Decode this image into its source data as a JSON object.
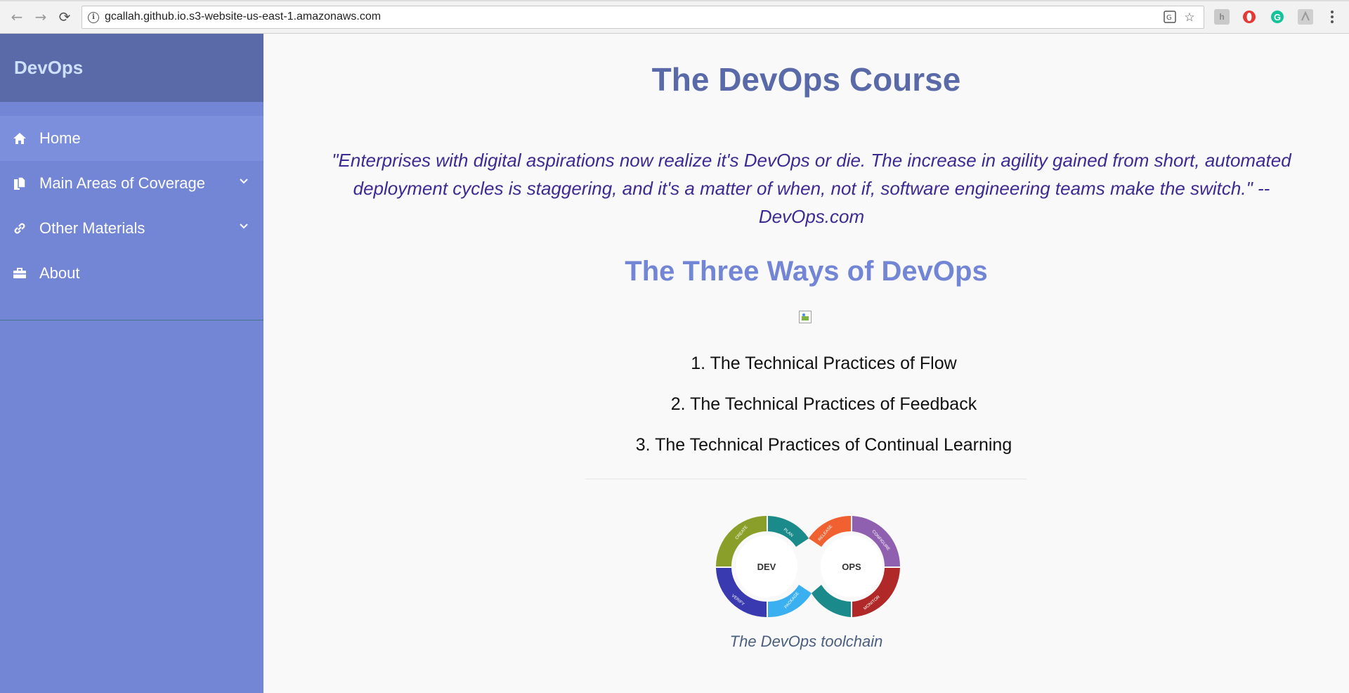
{
  "browser": {
    "url": "gcallah.github.io.s3-website-us-east-1.amazonaws.com",
    "icons": [
      "back-arrow-icon",
      "forward-arrow-icon",
      "reload-icon",
      "info-icon",
      "translate-icon",
      "star-icon",
      "extension-icon",
      "opera-icon",
      "grammarly-icon",
      "pdf-icon",
      "menu-icon"
    ]
  },
  "sidebar": {
    "brand": "DevOps",
    "items": [
      {
        "label": "Home",
        "icon": "home-icon"
      },
      {
        "label": "Main Areas of Coverage",
        "icon": "documents-icon",
        "dropdown": true
      },
      {
        "label": "Other Materials",
        "icon": "link-icon",
        "dropdown": true
      },
      {
        "label": "About",
        "icon": "briefcase-icon"
      }
    ]
  },
  "main": {
    "title": "The DevOps Course",
    "quote": "\"Enterprises with digital aspirations now realize it's DevOps or die. The increase in agility gained from short, automated deployment cycles is staggering, and it's a matter of when, not if, software engineering teams make the switch.\" -- DevOps.com",
    "subtitle": "The Three Ways of DevOps",
    "ways": [
      "1. The Technical Practices of Flow",
      "2. The Technical Practices of Feedback",
      "3. The Technical Practices of Continual Learning"
    ],
    "toolchain": {
      "dev_label": "DEV",
      "ops_label": "OPS",
      "stages": [
        "CREATE",
        "PLAN",
        "VERIFY",
        "PACKAGE",
        "RELEASE",
        "CONFIGURE",
        "MONITOR"
      ]
    },
    "caption": "The DevOps toolchain"
  },
  "colors": {
    "sidebar": "#7386d5",
    "sidebar_header": "#5a6aa8",
    "title": "#5a6aa8",
    "quote": "#3d2a92"
  }
}
